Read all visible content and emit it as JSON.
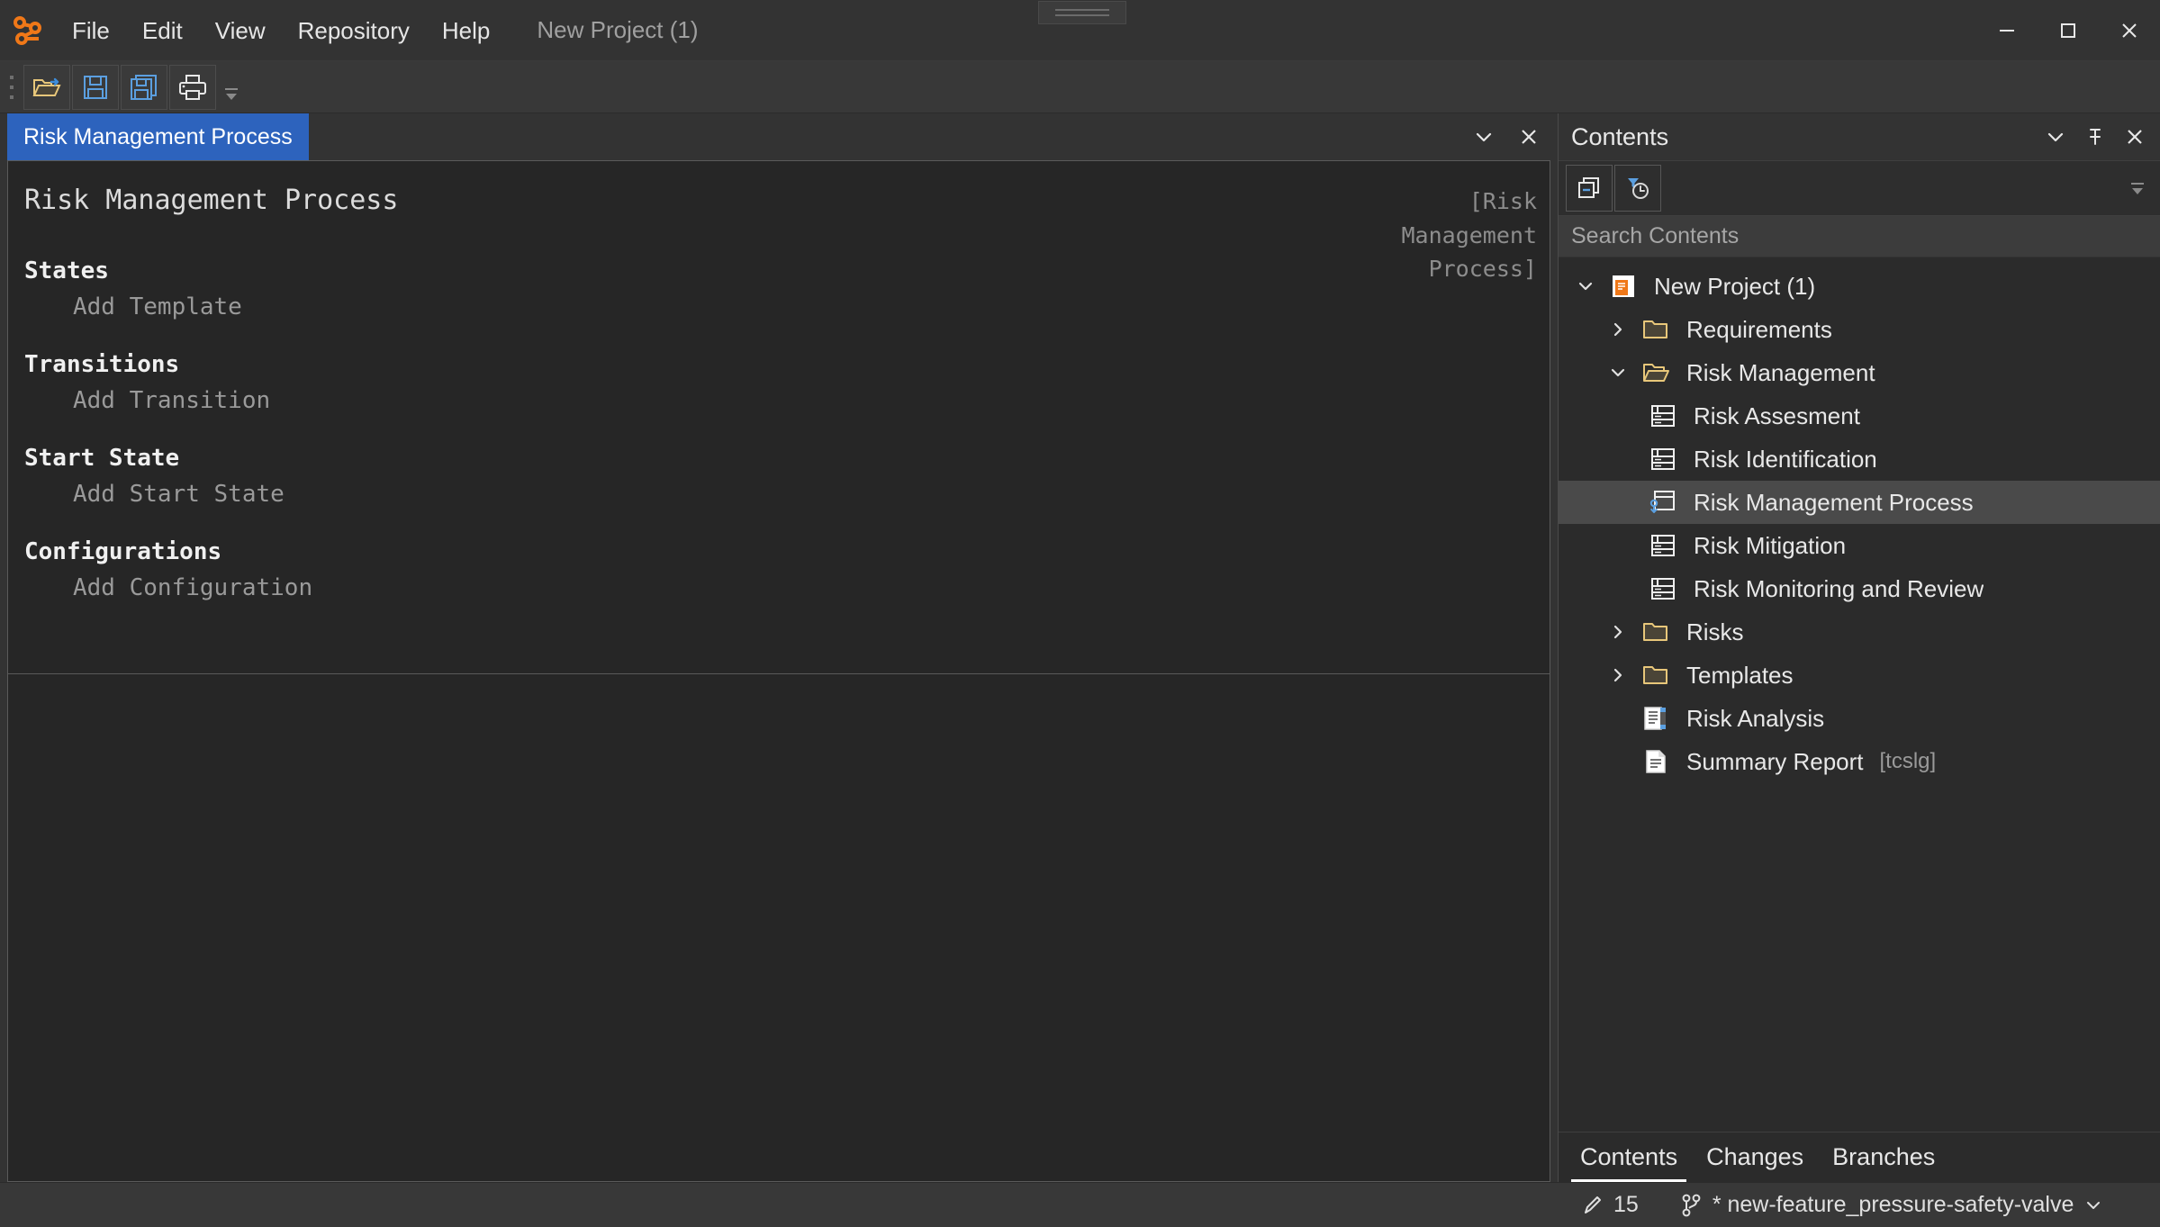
{
  "window": {
    "app_logo": "graph-nodes-logo",
    "project_title": "New Project (1)",
    "controls": {
      "minimize": "minimize-icon",
      "maximize": "maximize-icon",
      "close": "close-icon"
    }
  },
  "menubar": {
    "items": [
      {
        "label": "File"
      },
      {
        "label": "Edit"
      },
      {
        "label": "View"
      },
      {
        "label": "Repository"
      },
      {
        "label": "Help"
      }
    ]
  },
  "toolbar": {
    "buttons": [
      {
        "name": "open-folder-icon",
        "tooltip": "Open"
      },
      {
        "name": "save-icon",
        "tooltip": "Save"
      },
      {
        "name": "save-as-icon",
        "tooltip": "Save As"
      },
      {
        "name": "print-icon",
        "tooltip": "Print"
      }
    ],
    "overflow": "toolbar-overflow-icon"
  },
  "editor": {
    "tab": {
      "label": "Risk Management Process"
    },
    "tab_controls": {
      "chevron": "chevron-down-icon",
      "close": "close-icon"
    },
    "document_title": "Risk Management Process",
    "reference_tag": "[Risk Management Process]",
    "sections": [
      {
        "heading": "States",
        "action": "Add Template"
      },
      {
        "heading": "Transitions",
        "action": "Add Transition"
      },
      {
        "heading": "Start State",
        "action": "Add Start State"
      },
      {
        "heading": "Configurations",
        "action": "Add Configuration"
      }
    ]
  },
  "contents_panel": {
    "title": "Contents",
    "header_buttons": [
      {
        "name": "chevron-down-icon"
      },
      {
        "name": "pin-icon"
      },
      {
        "name": "close-icon"
      }
    ],
    "toolbar_buttons": [
      {
        "name": "collapse-all-icon"
      },
      {
        "name": "history-filter-icon"
      }
    ],
    "overflow": "panel-overflow-icon",
    "search": {
      "placeholder": "Search Contents",
      "value": ""
    },
    "tree": [
      {
        "label": "New Project (1)",
        "icon": "project-icon",
        "indent": 0,
        "twisty": "expanded",
        "selected": false,
        "suffix": ""
      },
      {
        "label": "Requirements",
        "icon": "folder-closed-icon",
        "indent": 1,
        "twisty": "collapsed",
        "selected": false,
        "suffix": ""
      },
      {
        "label": "Risk Management",
        "icon": "folder-open-icon",
        "indent": 1,
        "twisty": "expanded",
        "selected": false,
        "suffix": ""
      },
      {
        "label": "Risk Assesment",
        "icon": "table-doc-icon",
        "indent": 2,
        "twisty": "none",
        "selected": false,
        "suffix": ""
      },
      {
        "label": "Risk Identification",
        "icon": "table-doc-icon",
        "indent": 2,
        "twisty": "none",
        "selected": false,
        "suffix": ""
      },
      {
        "label": "Risk Management Process",
        "icon": "state-machine-icon",
        "indent": 2,
        "twisty": "none",
        "selected": true,
        "suffix": ""
      },
      {
        "label": "Risk Mitigation",
        "icon": "table-doc-icon",
        "indent": 2,
        "twisty": "none",
        "selected": false,
        "suffix": ""
      },
      {
        "label": "Risk Monitoring and Review",
        "icon": "table-doc-icon",
        "indent": 2,
        "twisty": "none",
        "selected": false,
        "suffix": ""
      },
      {
        "label": "Risks",
        "icon": "folder-closed-icon",
        "indent": 1,
        "twisty": "collapsed",
        "selected": false,
        "suffix": ""
      },
      {
        "label": "Templates",
        "icon": "folder-closed-icon",
        "indent": 1,
        "twisty": "collapsed",
        "selected": false,
        "suffix": ""
      },
      {
        "label": "Risk Analysis",
        "icon": "analysis-doc-icon",
        "indent": 1,
        "twisty": "none",
        "selected": false,
        "suffix": ""
      },
      {
        "label": "Summary Report",
        "icon": "report-doc-icon",
        "indent": 1,
        "twisty": "none",
        "selected": false,
        "suffix": "[tcslg]"
      }
    ],
    "bottom_tabs": [
      {
        "label": "Contents",
        "active": true
      },
      {
        "label": "Changes",
        "active": false
      },
      {
        "label": "Branches",
        "active": false
      }
    ]
  },
  "statusbar": {
    "edits_icon": "pencil-icon",
    "edits_count": "15",
    "branch_icon": "branch-icon",
    "branch_label": "* new-feature_pressure-safety-valve",
    "branch_chevron": "chevron-down-icon"
  },
  "colors": {
    "accent_tab": "#2d63bd",
    "logo_orange": "#f07818",
    "folder_tan": "#e8c77a",
    "icon_blue": "#5b9fe0",
    "panel_bg": "#2b2b2b",
    "chrome_bg": "#333333",
    "editor_bg": "#262626",
    "selection": "#4a4a4a"
  }
}
